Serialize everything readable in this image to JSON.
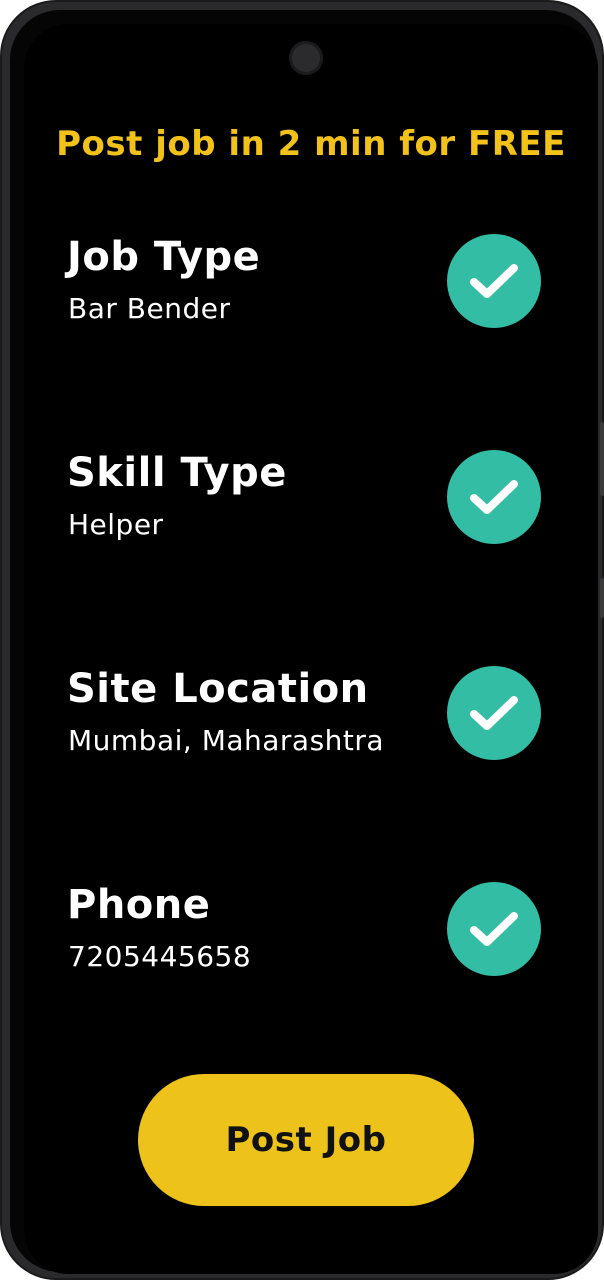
{
  "header": {
    "headline": "Post job in 2 min for FREE"
  },
  "fields": [
    {
      "label": "Job Type",
      "value": "Bar Bender",
      "status_icon": "check-icon"
    },
    {
      "label": "Skill Type",
      "value": "Helper",
      "status_icon": "check-icon"
    },
    {
      "label": "Site Location",
      "value": "Mumbai, Maharashtra",
      "status_icon": "check-icon"
    },
    {
      "label": "Phone",
      "value": "7205445658",
      "status_icon": "check-icon"
    }
  ],
  "actions": {
    "post_label": "Post Job"
  },
  "colors": {
    "accent": "#edc31b",
    "headline": "#f2c21b",
    "check": "#33bda5",
    "background": "#000000",
    "text": "#ffffff"
  }
}
